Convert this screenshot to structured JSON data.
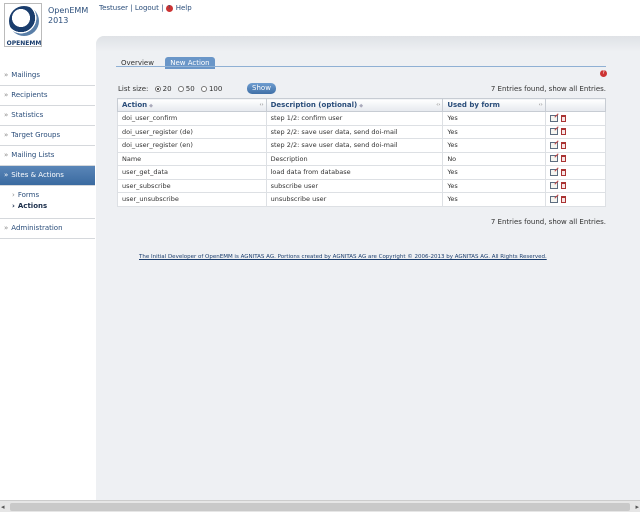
{
  "app": {
    "name_line1": "OpenEMM",
    "name_line2": "2013",
    "logo_text": "OPENEMM"
  },
  "top_links": {
    "user": "Testuser",
    "sep": "|",
    "logout": "Logout",
    "help": "Help"
  },
  "sidebar": {
    "items": [
      {
        "label": "Mailings"
      },
      {
        "label": "Recipients"
      },
      {
        "label": "Statistics"
      },
      {
        "label": "Target Groups"
      },
      {
        "label": "Mailing Lists"
      },
      {
        "label": "Sites & Actions"
      },
      {
        "label": "Administration"
      }
    ],
    "sub_items": [
      {
        "label": "Forms"
      },
      {
        "label": "Actions"
      }
    ]
  },
  "tabs": [
    {
      "label": "Overview"
    },
    {
      "label": "New Action"
    }
  ],
  "list": {
    "size_label": "List size:",
    "options": [
      "20",
      "50",
      "100"
    ],
    "selected": "20",
    "show_button": "Show",
    "entries_text": "7 Entries found, show all Entries."
  },
  "table": {
    "headers": [
      "Action",
      "Description (optional)",
      "Used by form"
    ],
    "rows": [
      {
        "action": "doi_user_confirm",
        "description": "step 1/2: confirm user",
        "used": "Yes"
      },
      {
        "action": "doi_user_register (de)",
        "description": "step 2/2: save user data, send doi-mail",
        "used": "Yes"
      },
      {
        "action": "doi_user_register (en)",
        "description": "step 2/2: save user data, send doi-mail",
        "used": "Yes"
      },
      {
        "action": "Name",
        "description": "Description",
        "used": "No"
      },
      {
        "action": "user_get_data",
        "description": "load data from database",
        "used": "Yes"
      },
      {
        "action": "user_subscribe",
        "description": "subscribe user",
        "used": "Yes"
      },
      {
        "action": "user_unsubscribe",
        "description": "unsubscribe user",
        "used": "Yes"
      }
    ]
  },
  "footer": "The Initial Developer of OpenEMM is AGNITAS AG. Portions created by AGNITAS AG are Copyright © 2006-2013 by AGNITAS AG. All Rights Reserved."
}
